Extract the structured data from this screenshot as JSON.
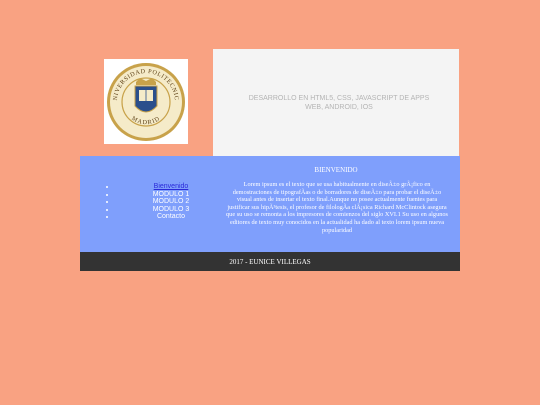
{
  "logo": {
    "outer_text": "UNIVERSIDAD POLITECNICA",
    "bottom_text": "MADRID"
  },
  "header": {
    "title": "DESARROLLO EN HTML5, CSS, JAVASCRIPT DE APPS WEB, ANDROID, IOS"
  },
  "menu": {
    "items": [
      {
        "label": "Bienvenido"
      },
      {
        "label": "MODULO 1"
      },
      {
        "label": "MODULO 2"
      },
      {
        "label": "MODULO 3"
      },
      {
        "label": "Contacto"
      }
    ]
  },
  "main": {
    "title": "BIENVENIDO",
    "text": "Lorem ipsum es el texto que se usa habitualmente en diseÃ±o grÃ¡fico en demostraciones de tipografÃ­as o de borradores de diseÃ±o para probar el diseÃ±o visual antes de insertar el texto final.Aunque no posee actualmente fuentes para justificar sus hipÃ³tesis, el profesor de filologÃ­a clÃ¡sica Richard McClintock asegura que su uso se remonta a los impresores de comienzos del siglo XVI.1 Su uso en algunos editores de texto muy conocidos en la actualidad ha dado al texto lorem ipsum nueva popularidad"
  },
  "footer": {
    "text": "2017 - EUNICE VILLEGAS"
  },
  "colors": {
    "page_bg": "#f9a282",
    "content_bg": "#7f9ffc",
    "footer_bg": "#333333",
    "link": "#2a2ad9",
    "seal_gold": "#c8a24a",
    "seal_blue": "#2b4f8c"
  }
}
